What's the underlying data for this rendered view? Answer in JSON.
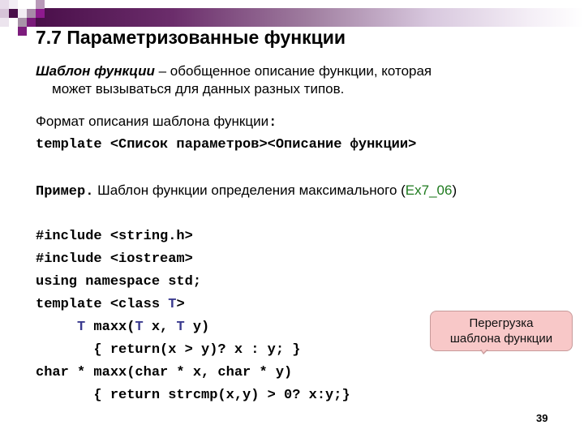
{
  "slide": {
    "title": "7.7 Параметризованные функции",
    "definition": {
      "term": "Шаблон функции",
      "dash": " – ",
      "text_line1": "обобщенное описание функции, которая",
      "text_line2": "может вызываться для данных разных типов."
    },
    "format": {
      "label": "Формат описания шаблона функции",
      "colon": ":",
      "syntax": "template <Список параметров><Описание функции>"
    },
    "example": {
      "label": "Пример.",
      "text": " Шаблон функции определения максимального (",
      "reference": "Ex7_06",
      "close": ")"
    },
    "code": {
      "line1": "#include <string.h>",
      "line2": "#include <iostream>",
      "line3": "using namespace std;",
      "line4_prefix": "template <class ",
      "line4_param": "T",
      "line4_suffix": ">",
      "line5_indent": "     ",
      "line5_t1": "T",
      "line5_mid1": " maxx(",
      "line5_t2": "T",
      "line5_mid2": " x, ",
      "line5_t3": "T",
      "line5_end": " y)",
      "line6": "       { return(x > y)? x : y; }",
      "line7": "char * maxx(char * x, char * y)",
      "line8": "       { return strcmp(x,y) > 0? x:y;}"
    },
    "callout": {
      "line1": "Перегрузка",
      "line2": "шаблона функции"
    },
    "page_number": "39"
  },
  "colors": {
    "reference_green": "#1e7a1e",
    "type_param_blue": "#3b3b8f",
    "callout_fill": "#f8c8c8",
    "band_dark": "#4a0f4a"
  }
}
